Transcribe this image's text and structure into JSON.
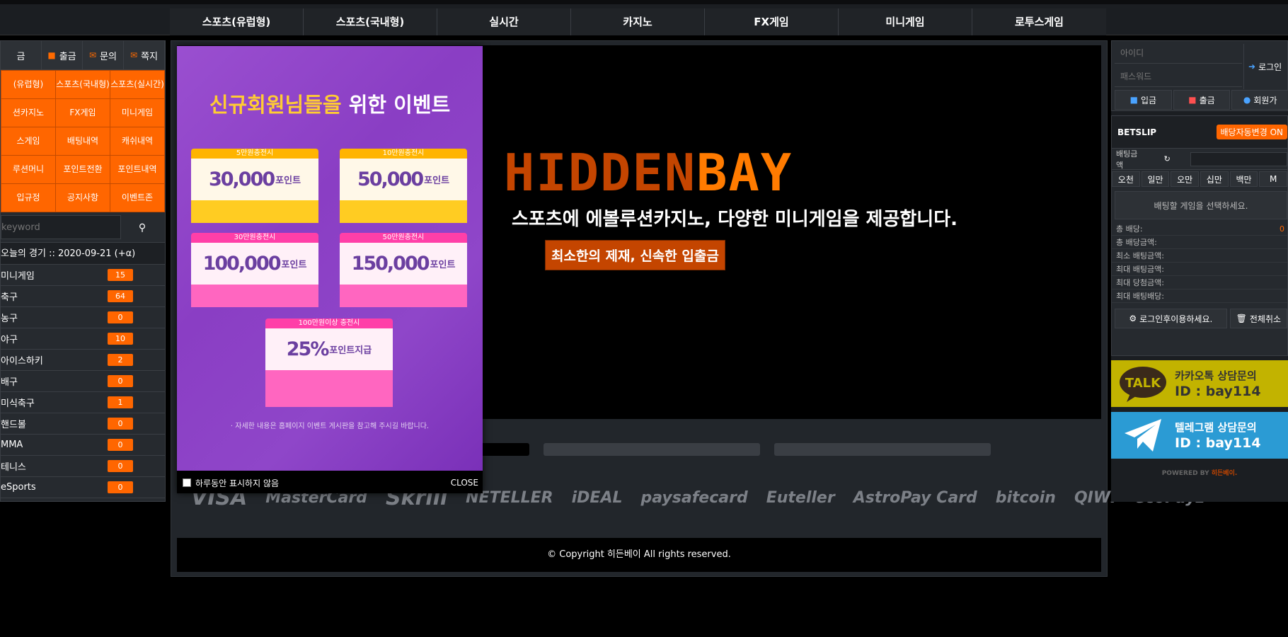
{
  "topnav": {
    "items": [
      "스포츠(유럽형)",
      "스포츠(국내형)",
      "실시간",
      "카지노",
      "FX게임",
      "미니게임",
      "로투스게임"
    ]
  },
  "left": {
    "actions": [
      {
        "label": "금",
        "icon": "deposit-icon"
      },
      {
        "label": "출금",
        "icon": "minus-icon"
      },
      {
        "label": "문의",
        "icon": "chat-icon"
      },
      {
        "label": "쪽지",
        "icon": "envelope-icon"
      }
    ],
    "grid": [
      "(유럽형)",
      "스포츠(국내형)",
      "스포츠(실시간)",
      "션카지노",
      "FX게임",
      "미니게임",
      "스게임",
      "배팅내역",
      "캐쉬내역",
      "루션머니",
      "포인트전환",
      "포인트내역",
      "입규정",
      "공지사항",
      "이벤트존"
    ],
    "search_placeholder": "keyword",
    "today_label": "오늘의 경기 :: 2020-09-21 (+α)",
    "sports": [
      {
        "name": "미니게임",
        "count": "15"
      },
      {
        "name": "축구",
        "count": "64"
      },
      {
        "name": "농구",
        "count": "0"
      },
      {
        "name": "야구",
        "count": "10"
      },
      {
        "name": "아이스하키",
        "count": "2"
      },
      {
        "name": "배구",
        "count": "0"
      },
      {
        "name": "미식축구",
        "count": "1"
      },
      {
        "name": "핸드볼",
        "count": "0"
      },
      {
        "name": "MMA",
        "count": "0"
      },
      {
        "name": "테니스",
        "count": "0"
      },
      {
        "name": "eSports",
        "count": "0"
      }
    ]
  },
  "banner": {
    "logo_part1": "HIDDEN",
    "logo_part2": "BAY",
    "tagline1": "스포츠에 에볼루션카지노, 다양한 미니게임을 제공합니다.",
    "tagline2": "최소한의 제재, 신속한 입출금"
  },
  "payments": [
    "VISA",
    "MasterCard",
    "Skrill",
    "NETELLER",
    "iDEAL",
    "paysafecard",
    "Euteller",
    "AstroPay Card",
    "bitcoin",
    "QIWI",
    "ecoPayz"
  ],
  "copyright": "© Copyright 히든베이 All rights reserved.",
  "popup": {
    "title_yellow": "신규회원님들을",
    "title_white": "위한 이벤트",
    "envelopes": [
      {
        "tab": "5만원충전시",
        "amount": "30,000",
        "unit": "포인트"
      },
      {
        "tab": "10만원충전시",
        "amount": "50,000",
        "unit": "포인트"
      },
      {
        "tab": "30만원충전시",
        "amount": "100,000",
        "unit": "포인트"
      },
      {
        "tab": "50만원충전시",
        "amount": "150,000",
        "unit": "포인트"
      },
      {
        "tab": "100만원이상 충전시",
        "amount": "25%",
        "unit": "포인트지급"
      }
    ],
    "note": "· 자세한 내용은 홈페이지 이벤트 게시판을 참고해 주시길 바랍니다.",
    "dont_show": "하루동안 표시하지 않음",
    "close": "CLOSE"
  },
  "right": {
    "id_placeholder": "아이디",
    "pw_placeholder": "패스워드",
    "login_label": "로그인",
    "member_buttons": [
      "입금",
      "출금",
      "회원가"
    ],
    "betslip_title": "BETSLIP",
    "auto_label": "배당자동변경 ON",
    "bet_amount_label": "배팅금액",
    "chips": [
      "오천",
      "일만",
      "오만",
      "십만",
      "백만",
      "M"
    ],
    "select_msg": "배팅할 게임을 선택하세요.",
    "rows": [
      {
        "label": "총 배당:",
        "value": "0"
      },
      {
        "label": "총 배당금액:",
        "value": ""
      },
      {
        "label": "최소 배팅금액:",
        "value": ""
      },
      {
        "label": "최대 배팅금액:",
        "value": ""
      },
      {
        "label": "최대 당첨금액:",
        "value": ""
      },
      {
        "label": "최대 배팅배당:",
        "value": ""
      }
    ],
    "login_use": "로그인후이용하세요.",
    "cancel_all": "전체취소",
    "kakao_line1": "카카오톡 상담문의",
    "kakao_id": "ID : bay114",
    "kakao_badge": "TALK",
    "telegram_line1": "텔레그램 상담문의",
    "telegram_id": "ID : bay114",
    "powered_label": "POWERED BY",
    "powered_brand": "히든베이."
  },
  "colors": {
    "accent": "#ff6600",
    "logo_dark": "#c44500",
    "logo_light": "#ff7b00",
    "popup_purple": "#8a3ec4",
    "kakao": "#c2b300",
    "telegram": "#2b9bd4"
  }
}
